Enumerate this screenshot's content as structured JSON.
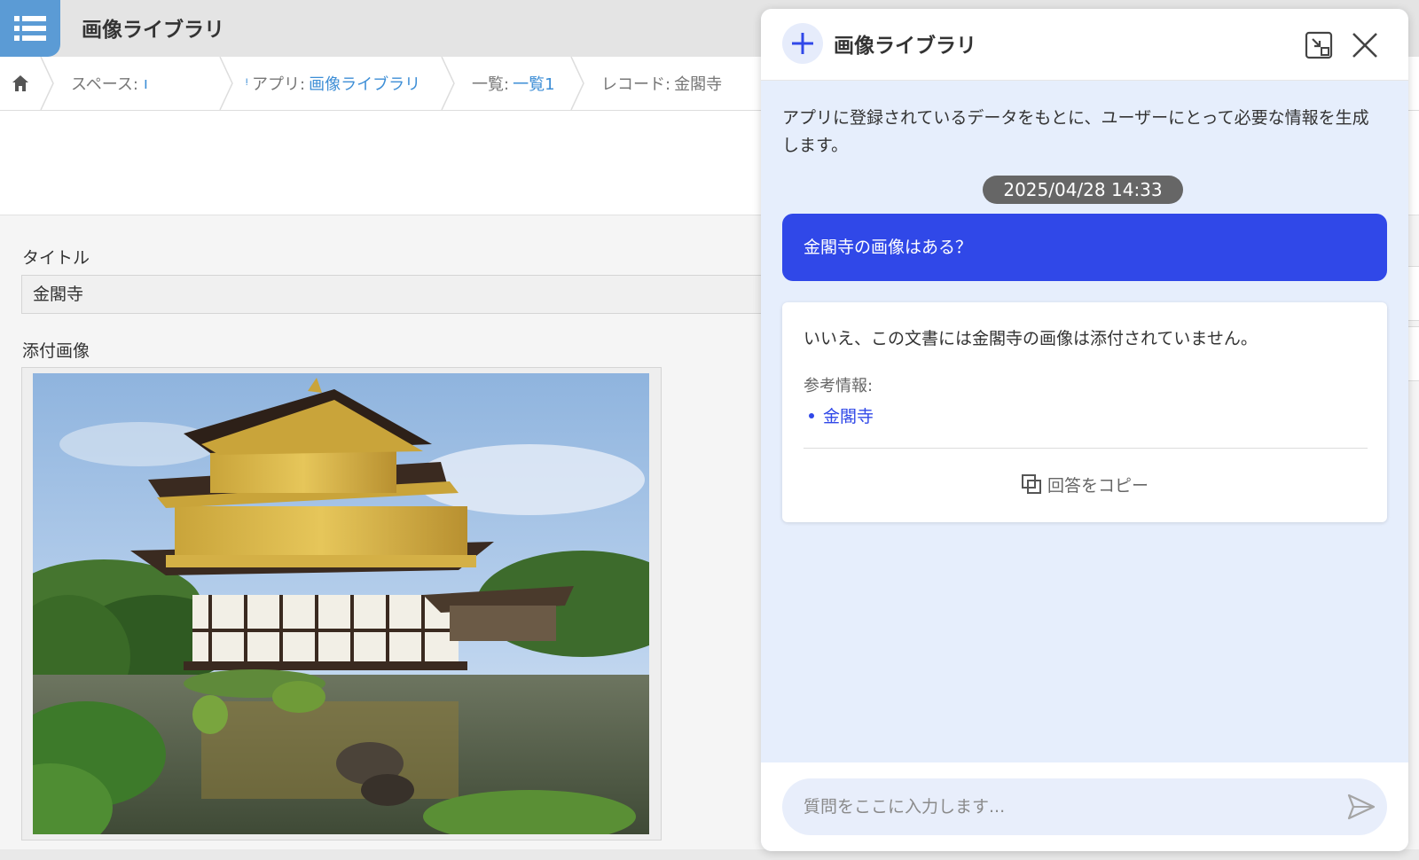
{
  "app": {
    "title": "画像ライブラリ",
    "icon": "list-icon",
    "accent": "#5b9bd5"
  },
  "breadcrumb": {
    "home_icon": "home-icon",
    "space_label": "スペース:",
    "space_value": "ı ᵎ",
    "app_label": "アプリ:",
    "app_value": "画像ライブラリ",
    "list_label": "一覧:",
    "list_value": "一覧1",
    "record_label": "レコード:",
    "record_value": "金閣寺"
  },
  "record": {
    "title_label": "タイトル",
    "title_value": "金閣寺",
    "image_label": "添付画像"
  },
  "chat": {
    "title": "画像ライブラリ",
    "new_icon": "plus-icon",
    "minimize_icon": "minimize-icon",
    "close_icon": "close-icon",
    "intro": "アプリに登録されているデータをもとに、ユーザーにとって必要な情報を生成します。",
    "timestamp": "2025/04/28 14:33",
    "user_message": "金閣寺の画像はある？",
    "answer": {
      "text": "いいえ、この文書には金閣寺の画像は添付されていません。",
      "ref_label": "参考情報:",
      "refs": [
        "金閣寺"
      ],
      "copy_label": "回答をコピー"
    },
    "input_placeholder": "質問をここに入力します...",
    "send_icon": "send-icon",
    "user_bubble_color": "#3048e8"
  }
}
